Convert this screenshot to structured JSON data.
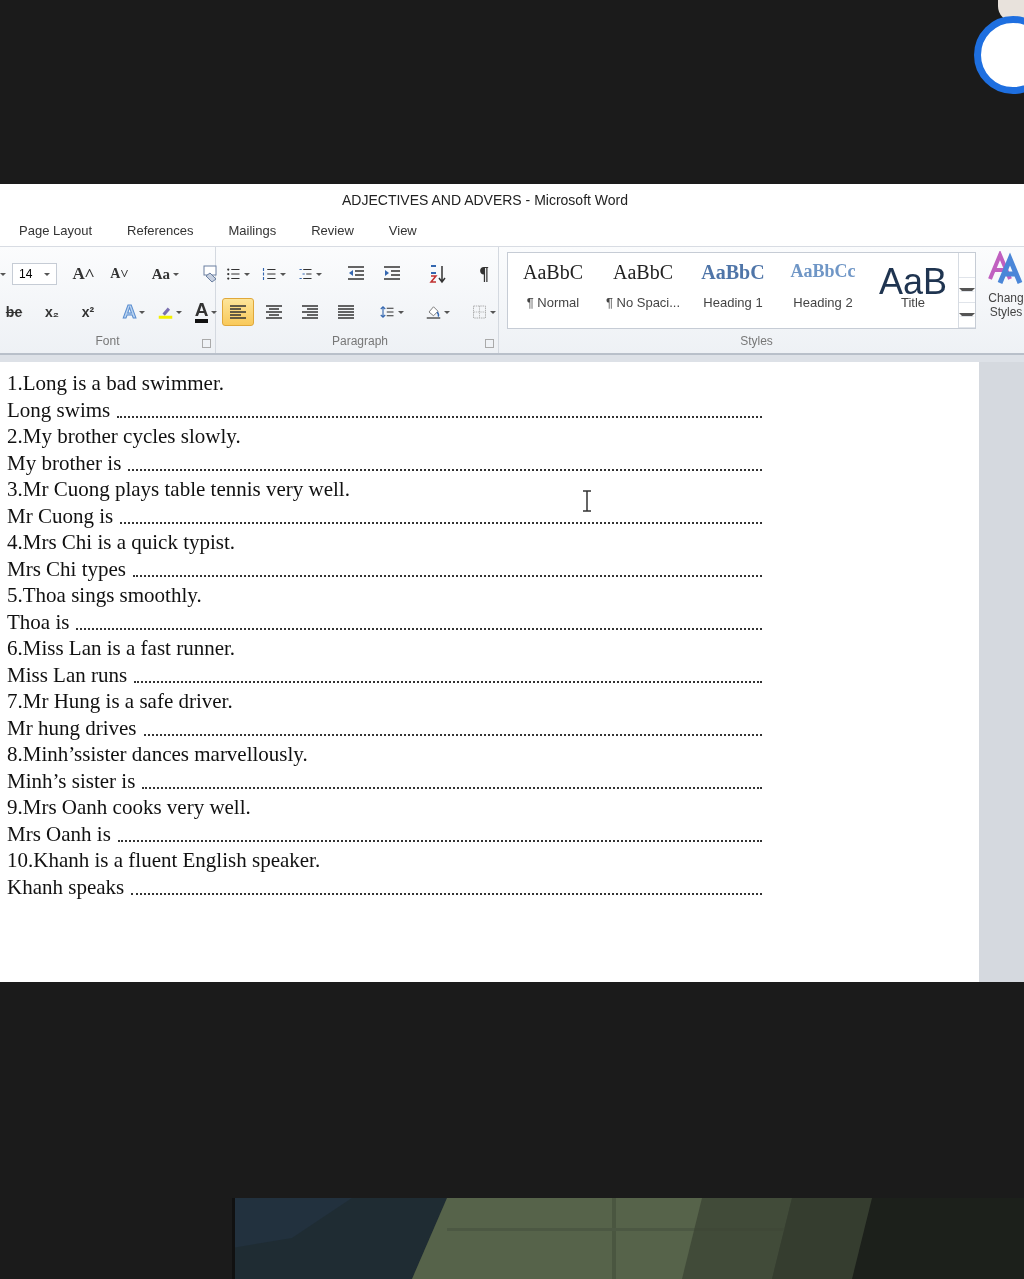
{
  "window": {
    "title": "ADJECTIVES AND ADVERS - Microsoft Word"
  },
  "tabs": [
    {
      "label": "Page Layout"
    },
    {
      "label": "References"
    },
    {
      "label": "Mailings"
    },
    {
      "label": "Review"
    },
    {
      "label": "View"
    }
  ],
  "ribbon": {
    "font_group": {
      "label": "Font",
      "size": "14",
      "row1": [
        {
          "kind": "grow",
          "text": "A˄"
        },
        {
          "kind": "shrink",
          "text": "A˅"
        },
        {
          "kind": "case",
          "text": "Aa"
        },
        {
          "kind": "clear-format"
        }
      ],
      "row2": [
        {
          "kind": "strike",
          "text": "be"
        },
        {
          "kind": "sub",
          "text": "x₂"
        },
        {
          "kind": "sup",
          "text": "x²"
        },
        {
          "kind": "effects",
          "text": "A"
        },
        {
          "kind": "highlight"
        },
        {
          "kind": "color",
          "text": "A"
        }
      ]
    },
    "paragraph_group": {
      "label": "Paragraph",
      "row1": [
        {
          "kind": "bullets"
        },
        {
          "kind": "numbering"
        },
        {
          "kind": "multilevel"
        },
        {
          "kind": "outdent"
        },
        {
          "kind": "indent"
        },
        {
          "kind": "sort"
        },
        {
          "kind": "pilcrow",
          "text": "¶"
        }
      ],
      "align": [
        {
          "kind": "left",
          "selected": true
        },
        {
          "kind": "center",
          "selected": false
        },
        {
          "kind": "right",
          "selected": false
        },
        {
          "kind": "justify",
          "selected": false
        }
      ],
      "row2": [
        {
          "kind": "line-spacing"
        },
        {
          "kind": "shading"
        },
        {
          "kind": "borders"
        }
      ]
    },
    "styles_group": {
      "label": "Styles",
      "items": [
        {
          "sample": "AaBbC",
          "label": "¶ Normal",
          "kind": "normal"
        },
        {
          "sample": "AaBbC",
          "label": "¶ No Spaci...",
          "kind": "normal"
        },
        {
          "sample": "AaBbC",
          "label": "Heading 1",
          "kind": "heading1"
        },
        {
          "sample": "AaBbCc",
          "label": "Heading 2",
          "kind": "heading2"
        },
        {
          "sample": "AaB",
          "label": "Title",
          "kind": "title"
        }
      ],
      "change_styles": [
        "Chang",
        "Styles"
      ]
    }
  },
  "document": {
    "lines": [
      {
        "kind": "prompt",
        "text": "1.Long is a bad swimmer."
      },
      {
        "kind": "answer",
        "text": "Long swims"
      },
      {
        "kind": "prompt",
        "text": "2.My brother cycles  slowly."
      },
      {
        "kind": "answer",
        "text": "My brother is"
      },
      {
        "kind": "prompt",
        "text": "3.Mr Cuong plays table tennis very well."
      },
      {
        "kind": "answer",
        "text": "Mr Cuong is"
      },
      {
        "kind": "prompt",
        "text": "4.Mrs Chi is  a quick typist."
      },
      {
        "kind": "answer",
        "text": "Mrs Chi types"
      },
      {
        "kind": "prompt",
        "text": "5.Thoa sings smoothly."
      },
      {
        "kind": "answer",
        "text": "Thoa is"
      },
      {
        "kind": "prompt",
        "text": "6.Miss Lan is a fast runner."
      },
      {
        "kind": "answer",
        "text": "Miss Lan runs"
      },
      {
        "kind": "prompt",
        "text": "7.Mr Hung is a safe driver."
      },
      {
        "kind": "answer",
        "text": "Mr hung drives"
      },
      {
        "kind": "prompt",
        "text": "8.Minh’ssister dances marvellously."
      },
      {
        "kind": "answer",
        "text": "Minh’s sister  is"
      },
      {
        "kind": "prompt",
        "text": "9.Mrs Oanh cooks very well."
      },
      {
        "kind": "answer",
        "text": "Mrs Oanh is"
      },
      {
        "kind": "prompt",
        "text": "10.Khanh is a fluent English speaker."
      },
      {
        "kind": "answer",
        "text": "Khanh speaks"
      }
    ]
  }
}
